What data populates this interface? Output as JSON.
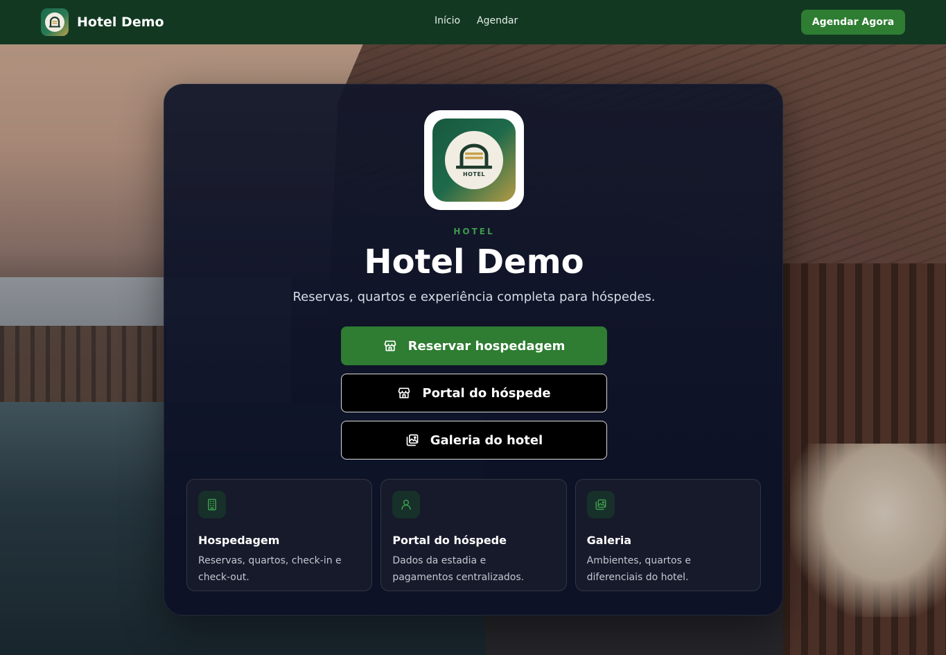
{
  "navbar": {
    "brand_name": "Hotel Demo",
    "links": [
      {
        "label": "Início"
      },
      {
        "label": "Agendar"
      }
    ],
    "cta_label": "Agendar Agora",
    "background": "#123822",
    "accent": "#2e7d32"
  },
  "hero": {
    "logo_text": "HOTEL",
    "eyebrow": "HOTEL",
    "title": "Hotel Demo",
    "subtitle": "Reservas, quartos e experiência completa para hóspedes."
  },
  "actions": [
    {
      "label": "Reservar hospedagem",
      "icon": "storefront-icon",
      "style": "primary"
    },
    {
      "label": "Portal do hóspede",
      "icon": "storefront-icon",
      "style": "outline"
    },
    {
      "label": "Galeria do hotel",
      "icon": "gallery-icon",
      "style": "outline"
    }
  ],
  "features": [
    {
      "icon": "building-icon",
      "title": "Hospedagem",
      "description": "Reservas, quartos, check-in e check-out."
    },
    {
      "icon": "user-icon",
      "title": "Portal do hóspede",
      "description": "Dados da estadia e pagamentos centralizados."
    },
    {
      "icon": "gallery-icon",
      "title": "Galeria",
      "description": "Ambientes, quartos e diferenciais do hotel."
    }
  ],
  "colors": {
    "card_background": "#12172a",
    "eyebrow": "#3d9a4c",
    "icon_green": "#3d9a4c"
  }
}
